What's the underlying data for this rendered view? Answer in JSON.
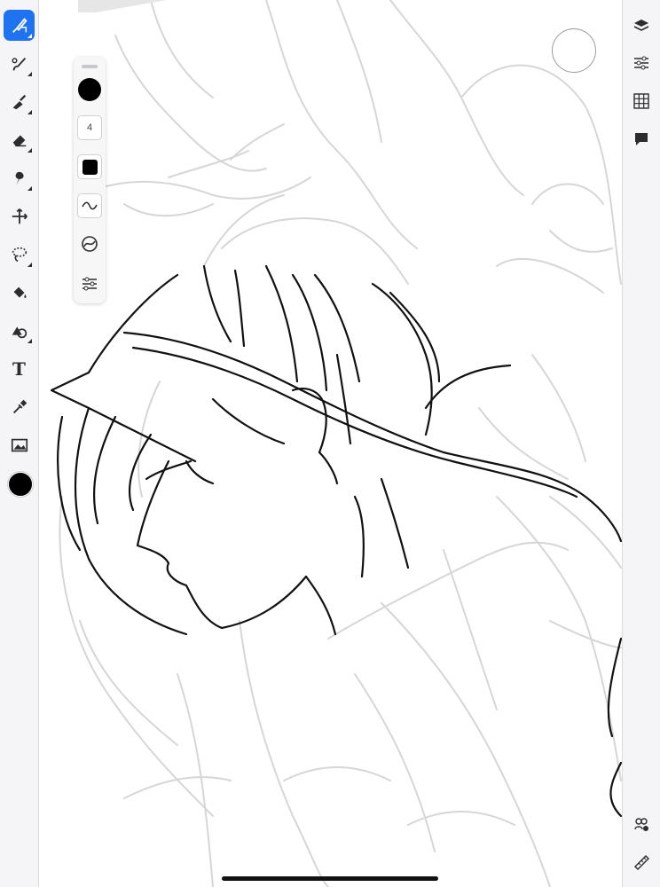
{
  "left_toolbar": {
    "tools": [
      {
        "name": "brush",
        "active": true
      },
      {
        "name": "brush-settings"
      },
      {
        "name": "smudge"
      },
      {
        "name": "eraser"
      },
      {
        "name": "blend"
      },
      {
        "name": "move"
      },
      {
        "name": "lasso-select"
      },
      {
        "name": "fill"
      },
      {
        "name": "shape"
      },
      {
        "name": "text",
        "label": "T"
      },
      {
        "name": "eyedropper"
      },
      {
        "name": "image"
      }
    ],
    "active_color": "#000000"
  },
  "brush_panel": {
    "color": "#000000",
    "size_value": "4",
    "opacity_color": "#000000"
  },
  "right_toolbar": {
    "tools": [
      "layers-icon",
      "adjustments-icon",
      "grid-icon",
      "comment-icon",
      "group-icon",
      "ruler-icon"
    ]
  },
  "colors": {
    "accent": "#1f73f0",
    "toolbar_bg": "#f5f5f7",
    "sketch_line": "#d8d8d8",
    "ink_line": "#111111"
  }
}
